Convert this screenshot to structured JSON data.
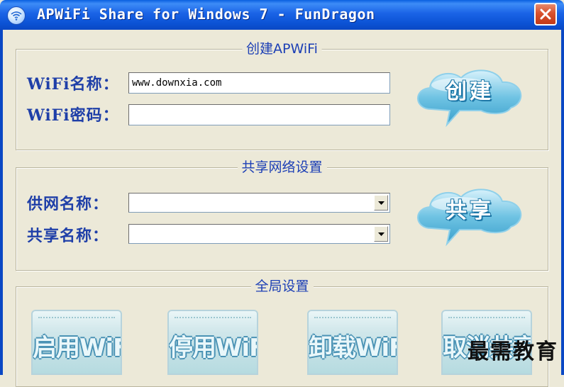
{
  "window": {
    "title": "APWiFi Share for Windows 7 - FunDragon"
  },
  "create_group": {
    "title": "创建APWiFi",
    "ssid_label": "WiFi名称：",
    "ssid_value": "www.downxia.com",
    "password_label": "WiFi密码：",
    "password_value": "",
    "create_button_label": "创建"
  },
  "share_group": {
    "title": "共享网络设置",
    "source_label": "供网名称：",
    "source_value": "",
    "share_label": "共享名称：",
    "share_value": "",
    "share_button_label": "共享"
  },
  "global_group": {
    "title": "全局设置",
    "buttons": [
      "启用WiFi",
      "停用WiFi",
      "卸载WiFi",
      "取消共享"
    ]
  },
  "watermark": "最需教育",
  "colors": {
    "titlebar": "#0b52d4",
    "window_bg": "#ece9d8",
    "label_blue": "#1f3fa8",
    "close_red": "#d9512e",
    "cloud_blue": "#5bb6d8"
  }
}
